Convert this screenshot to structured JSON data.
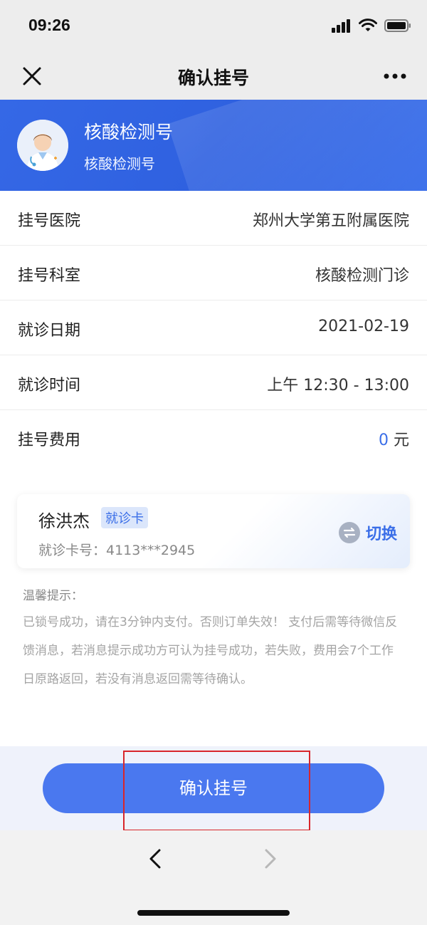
{
  "status_bar": {
    "time": "09:26"
  },
  "nav": {
    "title": "确认挂号"
  },
  "banner": {
    "title": "核酸检测号",
    "subtitle": "核酸检测号"
  },
  "info": [
    {
      "label": "挂号医院",
      "value": "郑州大学第五附属医院"
    },
    {
      "label": "挂号科室",
      "value": "核酸检测门诊"
    },
    {
      "label": "就诊日期",
      "value": "2021-02-19"
    },
    {
      "label": "就诊时间",
      "value": "上午 12:30 - 13:00"
    },
    {
      "label": "挂号费用",
      "amount": "0",
      "unit": "元"
    }
  ],
  "patient_card": {
    "name": "徐洪杰",
    "badge": "就诊卡",
    "card_number": "就诊卡号：4113***2945",
    "switch_label": "切换"
  },
  "tips": {
    "title": "温馨提示：",
    "body": "已锁号成功，请在3分钟内支付。否则订单失效！ 支付后需等待微信反馈消息，若消息提示成功方可认为挂号成功，若失败，费用会7个工作日原路返回，若没有消息返回需等待确认。"
  },
  "actions": {
    "confirm_label": "确认挂号"
  },
  "colors": {
    "accent": "#4a78ef",
    "banner": "#3568e6",
    "highlight": "#d8262b"
  }
}
